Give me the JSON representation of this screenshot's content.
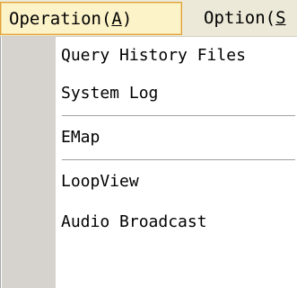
{
  "menubar": {
    "menus": [
      {
        "label": "Operation(",
        "mnemonic": "A",
        "suffix": ")"
      },
      {
        "label": "Option(",
        "mnemonic": "S",
        "suffix": ""
      }
    ]
  },
  "dropdown": {
    "items": [
      {
        "label": "Query History Files"
      },
      {
        "label": "System Log"
      },
      {
        "label": "EMap"
      },
      {
        "label": "LoopView"
      },
      {
        "label": "Audio Broadcast"
      }
    ]
  },
  "colors": {
    "menubar_bg": "#ece9d8",
    "active_menu_bg": "#fdf3c9",
    "active_menu_border": "#e0a13a",
    "gutter": "#d6d3ce",
    "separator": "#a0a0a0"
  }
}
